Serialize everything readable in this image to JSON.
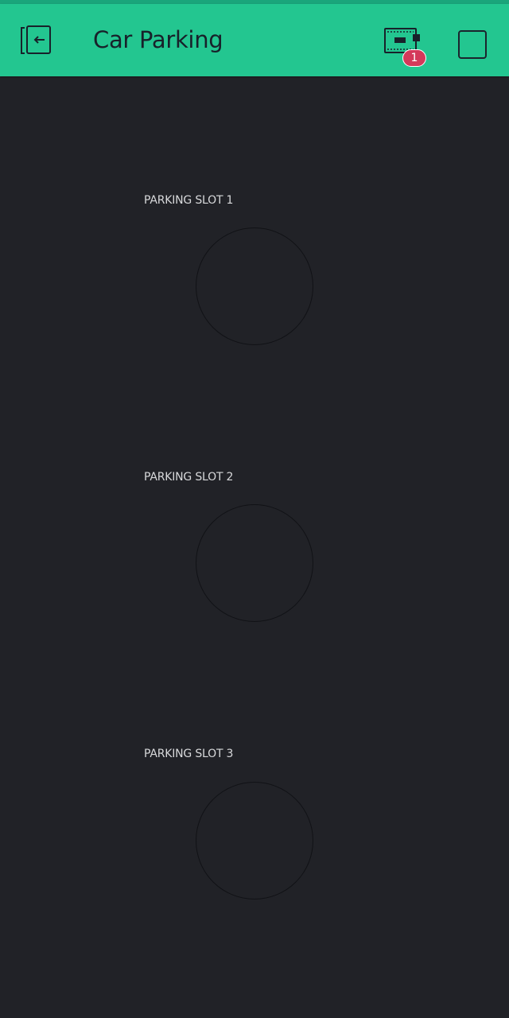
{
  "app": {
    "title": "Car Parking",
    "colors": {
      "header": "#23c690",
      "background": "#212227",
      "badge": "#d4395a"
    }
  },
  "header": {
    "back_icon": "exit-icon",
    "device_icon": "device-icon",
    "device_badge": "1",
    "play_icon": "square-icon"
  },
  "widgets": [
    {
      "label": "PARKING SLOT 1",
      "type": "led",
      "state": "off"
    },
    {
      "label": "PARKING SLOT 2",
      "type": "led",
      "state": "off"
    },
    {
      "label": "PARKING SLOT 3",
      "type": "led",
      "state": "off"
    }
  ]
}
